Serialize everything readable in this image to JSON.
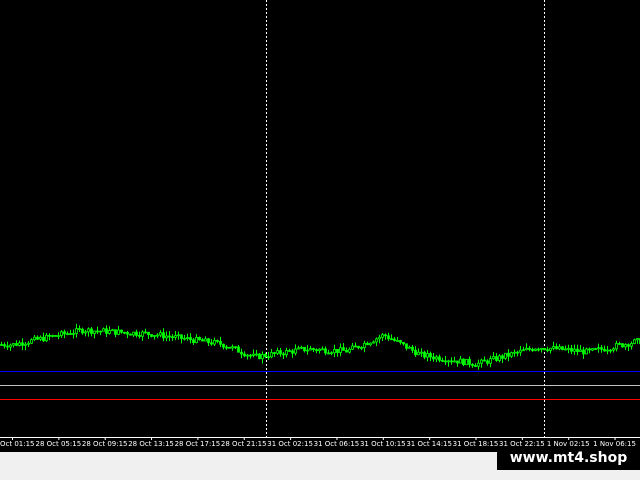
{
  "brand": {
    "watermark": "www.mt4.shop"
  },
  "colors": {
    "background": "#000000",
    "bull_candle": "#00ff00",
    "bear_candle": "#00ff00",
    "grid_line": "#ffffff",
    "level_blue": "#0000ff",
    "level_gray": "#c0c0c0",
    "level_red": "#ff0000",
    "axis_text": "#ffffff"
  },
  "chart_data": {
    "type": "candlestick",
    "title": "",
    "xlabel": "",
    "ylabel": "",
    "x_ticks": [
      "Oct 01:15",
      "28 Oct 05:15",
      "28 Oct 09:15",
      "28 Oct 13:15",
      "28 Oct 17:15",
      "28 Oct 21:15",
      "31 Oct 02:15",
      "31 Oct 06:15",
      "31 Oct 10:15",
      "31 Oct 14:15",
      "31 Oct 18:15",
      "31 Oct 22:15",
      "1 Nov 02:15",
      "1 Nov 06:15"
    ],
    "session_separators": [
      "28 Oct 21:15",
      "31 Oct 22:15"
    ],
    "horizontal_levels": [
      {
        "value": 0.66,
        "color": "blue"
      },
      {
        "value": 0.52,
        "color": "gray"
      },
      {
        "value": 0.38,
        "color": "red"
      }
    ],
    "y_range": [
      0,
      1
    ],
    "close_path": [
      [
        0,
        0.925
      ],
      [
        1.5,
        1.07
      ],
      [
        3,
        1.03
      ],
      [
        4.5,
        0.93
      ],
      [
        5.2,
        0.8
      ],
      [
        6.3,
        0.88
      ],
      [
        7.2,
        0.86
      ],
      [
        8.0,
        1.02
      ],
      [
        8.8,
        0.82
      ],
      [
        10.0,
        0.73
      ],
      [
        11.3,
        0.9
      ],
      [
        12.4,
        0.85
      ],
      [
        13.5,
        0.96
      ],
      [
        15.0,
        0.9
      ],
      [
        16.0,
        0.885
      ],
      [
        17.4,
        0.905
      ],
      [
        18.9,
        0.82
      ],
      [
        20.5,
        0.79
      ],
      [
        22.0,
        0.86
      ],
      [
        23.0,
        0.72
      ],
      [
        24.6,
        0.545
      ],
      [
        26.1,
        0.49
      ],
      [
        27.3,
        0.5
      ],
      [
        28.3,
        0.47
      ],
      [
        30.0,
        0.48
      ],
      [
        31.5,
        0.525
      ],
      [
        32.8,
        0.565
      ],
      [
        33.6,
        0.6
      ],
      [
        34.3,
        0.69
      ],
      [
        34.6,
        0.775
      ]
    ]
  }
}
